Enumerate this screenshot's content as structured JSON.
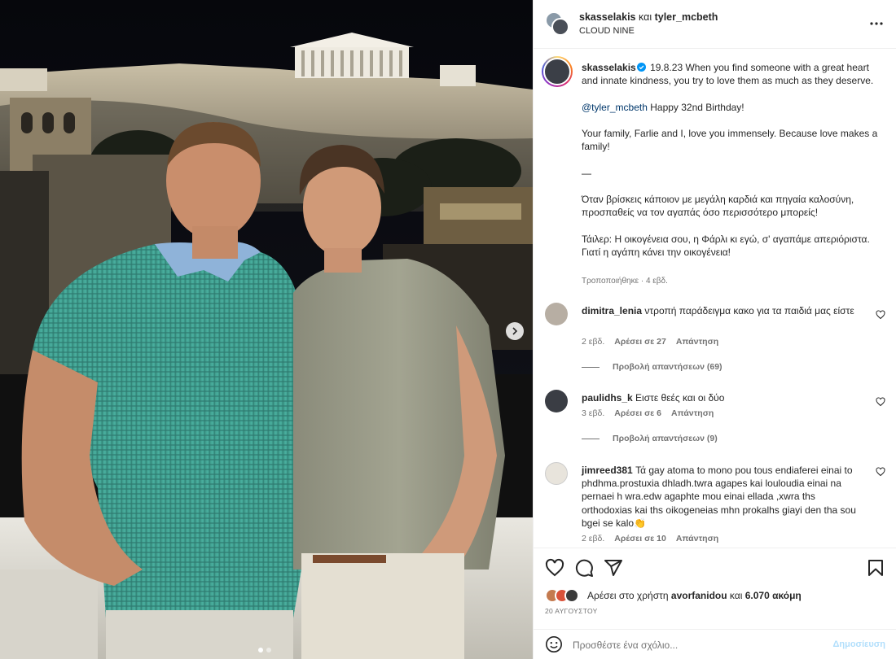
{
  "header": {
    "user1": "skasselakis",
    "and": "και",
    "user2": "tyler_mcbeth",
    "location": "CLOUD NINE"
  },
  "caption": {
    "username": "skasselakis",
    "lines": [
      "19.8.23 When you find someone with a great heart and innate kindness, you try to love them as much as they deserve.",
      "",
      "Happy 32nd Birthday!",
      "",
      "Your family, Farlie and I, love you immensely. Because love makes a family!",
      "",
      "—",
      "",
      "Όταν βρίσκεις κάποιον με μεγάλη καρδιά και πηγαία καλοσύνη, προσπαθείς να τον αγαπάς όσο περισσότερο μπορείς!",
      "",
      "Τάιλερ: Η οικογένεια σου, η Φάρλι κι εγώ, σ' αγαπάμε απεριόριστα. Γιατί η αγάπη κάνει την οικογένεια!"
    ],
    "mention": "@tyler_mcbeth",
    "edited": "Τροποποιήθηκε · 4 εβδ."
  },
  "comments": [
    {
      "username": "dimitra_lenia",
      "text": "ντροπή παράδειγμα κακο για τα παιδιά μας είστε",
      "time": "2 εβδ.",
      "likes": "Αρέσει σε 27",
      "reply": "Απάντηση",
      "view_replies": "Προβολή απαντήσεων (69)"
    },
    {
      "username": "paulidhs_k",
      "text": "Ειστε θεές και οι δύο",
      "time": "3 εβδ.",
      "likes": "Αρέσει σε 6",
      "reply": "Απάντηση",
      "view_replies": "Προβολή απαντήσεων (9)"
    },
    {
      "username": "jimreed381",
      "text": "Τά gay atoma to mono pou tous endiaferei einai to phdhma.prostuxia dhladh.twra agapes kai louloudia einai na pernaei h wra.edw agaphte mou einai ellada ,xwra ths orthodoxias kai ths oikogeneias mhn prokalhs giayi den tha sou bgei se kalo👏",
      "time": "2 εβδ.",
      "likes": "Αρέσει σε 10",
      "reply": "Απάντηση"
    }
  ],
  "likes": {
    "prefix": "Αρέσει στο χρήστη",
    "user": "avorfanidou",
    "conj": "και",
    "count": "6.070 ακόμη"
  },
  "date": "20 ΑΥΓΟΥΣΤΟΥ",
  "add_comment": {
    "placeholder": "Προσθέστε ένα σχόλιο...",
    "post_label": "Δημοσίευση"
  },
  "icons": {
    "like": "heart-icon",
    "comment": "comment-icon",
    "share": "share-icon",
    "save": "bookmark-icon",
    "more": "more-icon",
    "emoji": "emoji-icon",
    "next": "chevron-right-icon"
  },
  "carousel": {
    "slides": 2,
    "active": 1
  },
  "colors": {
    "link": "#00376b",
    "muted": "#737373",
    "post_disabled": "#b2dffc",
    "verified": "#0095f6"
  }
}
